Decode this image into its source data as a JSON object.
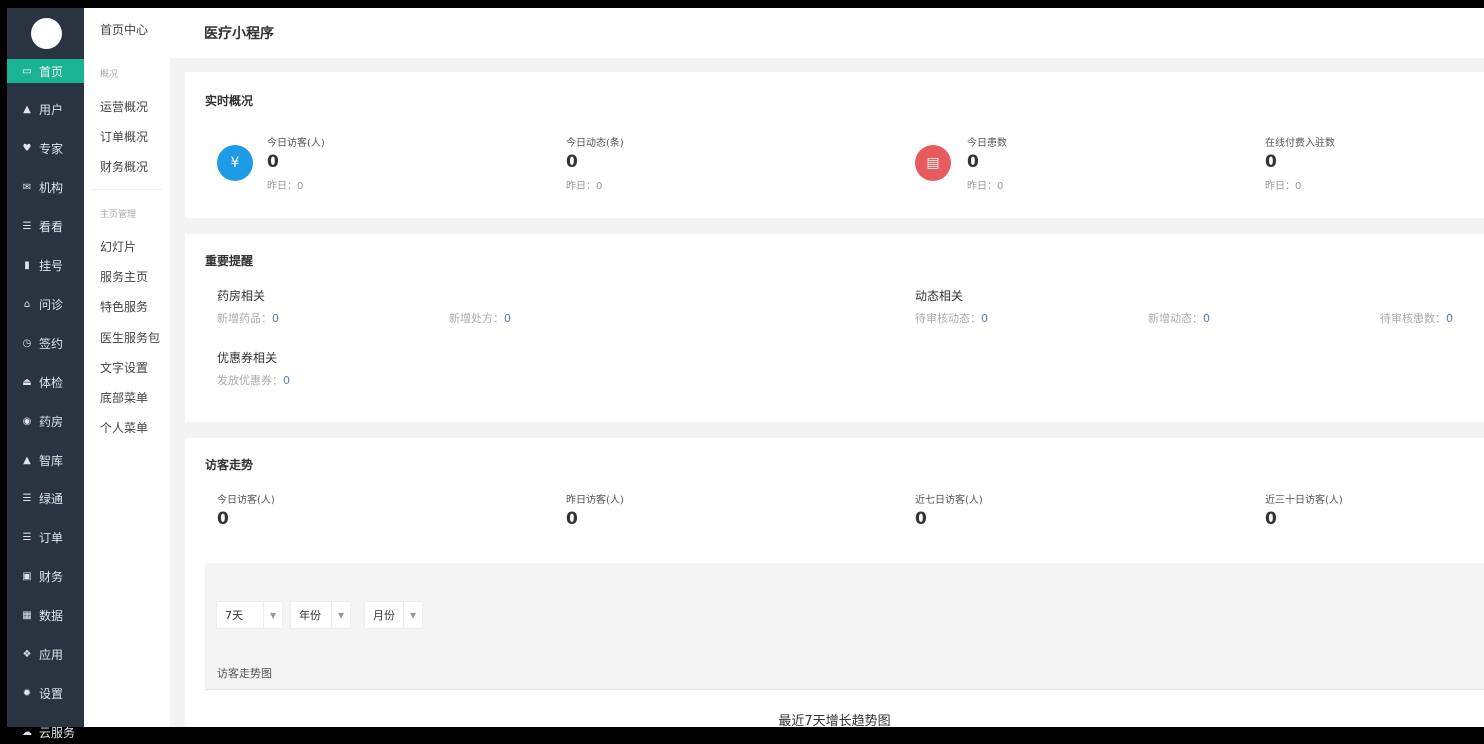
{
  "sidebar": {
    "items": [
      {
        "label": "首页",
        "icon": "monitor-icon",
        "glyph": "▭",
        "active": true
      },
      {
        "label": "用户",
        "icon": "user-icon",
        "glyph": "▲"
      },
      {
        "label": "专家",
        "icon": "heart-icon",
        "glyph": "♥"
      },
      {
        "label": "机构",
        "icon": "envelope-icon",
        "glyph": "✉"
      },
      {
        "label": "看看",
        "icon": "list-icon",
        "glyph": "☰"
      },
      {
        "label": "挂号",
        "icon": "signal-icon",
        "glyph": "▮"
      },
      {
        "label": "问诊",
        "icon": "home-icon",
        "glyph": "⌂"
      },
      {
        "label": "签约",
        "icon": "clock-icon",
        "glyph": "◷"
      },
      {
        "label": "体检",
        "icon": "inbox-icon",
        "glyph": "⏏"
      },
      {
        "label": "药房",
        "icon": "play-circle-icon",
        "glyph": "◉"
      },
      {
        "label": "智库",
        "icon": "lock-icon",
        "glyph": "▲"
      },
      {
        "label": "绿通",
        "icon": "list-icon",
        "glyph": "☰"
      },
      {
        "label": "订单",
        "icon": "list-icon",
        "glyph": "☰"
      },
      {
        "label": "财务",
        "icon": "money-icon",
        "glyph": "▣"
      },
      {
        "label": "数据",
        "icon": "table-icon",
        "glyph": "▦"
      },
      {
        "label": "应用",
        "icon": "cubes-icon",
        "glyph": "❖"
      },
      {
        "label": "设置",
        "icon": "gear-icon",
        "glyph": "✹"
      },
      {
        "label": "云服务",
        "icon": "cloud-icon",
        "glyph": "☁"
      }
    ]
  },
  "submenu": {
    "title": "首页中心",
    "section1": "概况",
    "items1": [
      "运营概况",
      "订单概况",
      "财务概况"
    ],
    "section2": "主页管理",
    "items2": [
      "幻灯片",
      "服务主页",
      "特色服务",
      "医生服务包",
      "文字设置",
      "底部菜单",
      "个人菜单"
    ]
  },
  "header": {
    "title": "医疗小程序"
  },
  "realtime": {
    "title": "实时概况",
    "stats": [
      {
        "label": "今日访客(人)",
        "value": "0",
        "yesterday": "昨日：0",
        "icon": "money-bag-icon",
        "color": "#1e9be6"
      },
      {
        "label": "今日动态(条)",
        "value": "0",
        "yesterday": "昨日：0"
      },
      {
        "label": "今日患数",
        "value": "0",
        "yesterday": "昨日：0",
        "icon": "inbox-icon",
        "color": "#e75b5f"
      },
      {
        "label": "在线付费入驻数",
        "value": "0",
        "yesterday": "昨日：0"
      }
    ]
  },
  "reminders": {
    "title": "重要提醒",
    "pharmacy": {
      "title": "药房相关",
      "items": [
        {
          "label": "新增药品：",
          "value": "0"
        },
        {
          "label": "新增处方：",
          "value": "0"
        }
      ]
    },
    "dynamic": {
      "title": "动态相关",
      "items": [
        {
          "label": "待审核动态：",
          "value": "0"
        },
        {
          "label": "新增动态：",
          "value": "0"
        },
        {
          "label": "待审核患数：",
          "value": "0"
        }
      ]
    },
    "coupon": {
      "title": "优惠券相关",
      "items": [
        {
          "label": "发放优惠券：",
          "value": "0"
        }
      ]
    }
  },
  "visitors": {
    "title": "访客走势",
    "stats": [
      {
        "label": "今日访客(人)",
        "value": "0"
      },
      {
        "label": "昨日访客(人)",
        "value": "0"
      },
      {
        "label": "近七日访客(人)",
        "value": "0"
      },
      {
        "label": "近三十日访客(人)",
        "value": "0"
      }
    ],
    "filters": [
      "7天",
      "年份",
      "月份"
    ],
    "chart_label": "访客走势图",
    "chart_title": "最近7天增长趋势图"
  }
}
